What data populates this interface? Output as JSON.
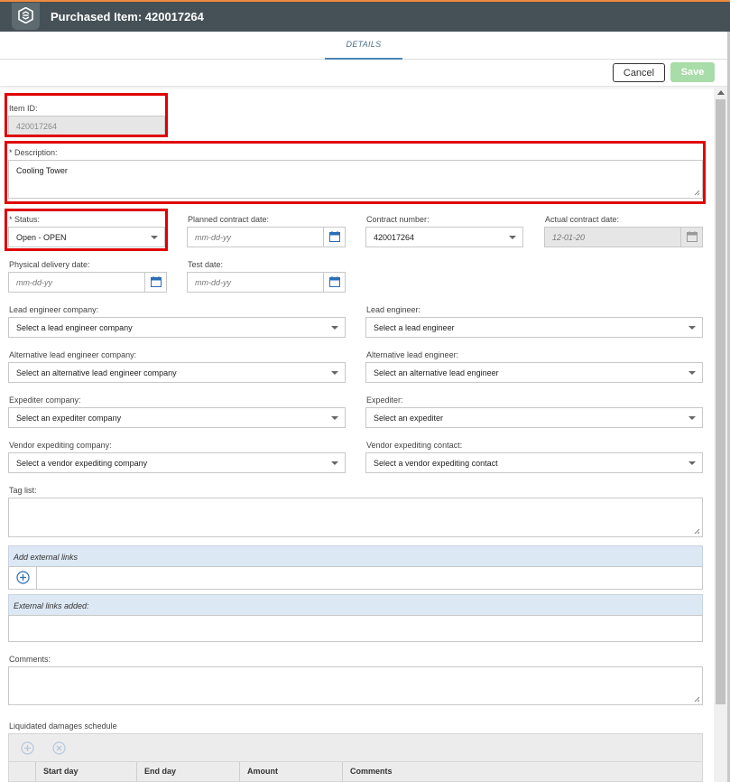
{
  "window": {
    "title": "Purchased Item: 420017264",
    "logo_icon": "app-logo-icon"
  },
  "tabs": [
    {
      "label": "DETAILS",
      "active": true
    }
  ],
  "toolbar": {
    "cancel_label": "Cancel",
    "save_label": "Save",
    "save_enabled": false
  },
  "form": {
    "item_id": {
      "label": "Item ID:",
      "value": "420017264",
      "disabled": true
    },
    "description": {
      "label": "* Description:",
      "value": "Cooling Tower"
    },
    "status": {
      "label": "* Status:",
      "value": "Open - OPEN"
    },
    "planned_contract_date": {
      "label": "Planned contract date:",
      "placeholder": "mm-dd-yy"
    },
    "contract_number": {
      "label": "Contract number:",
      "value": "420017264"
    },
    "actual_contract_date": {
      "label": "Actual contract date:",
      "value": "12-01-20",
      "disabled": true
    },
    "physical_delivery_date": {
      "label": "Physical delivery date:",
      "placeholder": "mm-dd-yy"
    },
    "test_date": {
      "label": "Test date:",
      "placeholder": "mm-dd-yy"
    },
    "lead_engineer_company": {
      "label": "Lead engineer company:",
      "placeholder": "Select a lead engineer company"
    },
    "lead_engineer": {
      "label": "Lead engineer:",
      "placeholder": "Select a lead engineer"
    },
    "alt_lead_engineer_company": {
      "label": "Alternative lead engineer company:",
      "placeholder": "Select an alternative lead engineer company"
    },
    "alt_lead_engineer": {
      "label": "Alternative lead engineer:",
      "placeholder": "Select an alternative lead engineer"
    },
    "expediter_company": {
      "label": "Expediter company:",
      "placeholder": "Select an expediter company"
    },
    "expediter": {
      "label": "Expediter:",
      "placeholder": "Select an expediter"
    },
    "vendor_expediting_company": {
      "label": "Vendor expediting company:",
      "placeholder": "Select a vendor expediting company"
    },
    "vendor_expediting_contact": {
      "label": "Vendor expediting contact:",
      "placeholder": "Select a vendor expediting contact"
    },
    "tag_list": {
      "label": "Tag list:"
    },
    "add_external_links": {
      "label": "Add external links"
    },
    "external_links_added": {
      "label": "External links added:"
    },
    "comments": {
      "label": "Comments:"
    },
    "liquidated_damages": {
      "label": "Liquidated damages schedule",
      "columns": [
        "Start day",
        "End day",
        "Amount",
        "Comments"
      ]
    }
  },
  "highlight_color": "#e00000",
  "accent_color": "#4a86b6",
  "header_color": "#455156"
}
